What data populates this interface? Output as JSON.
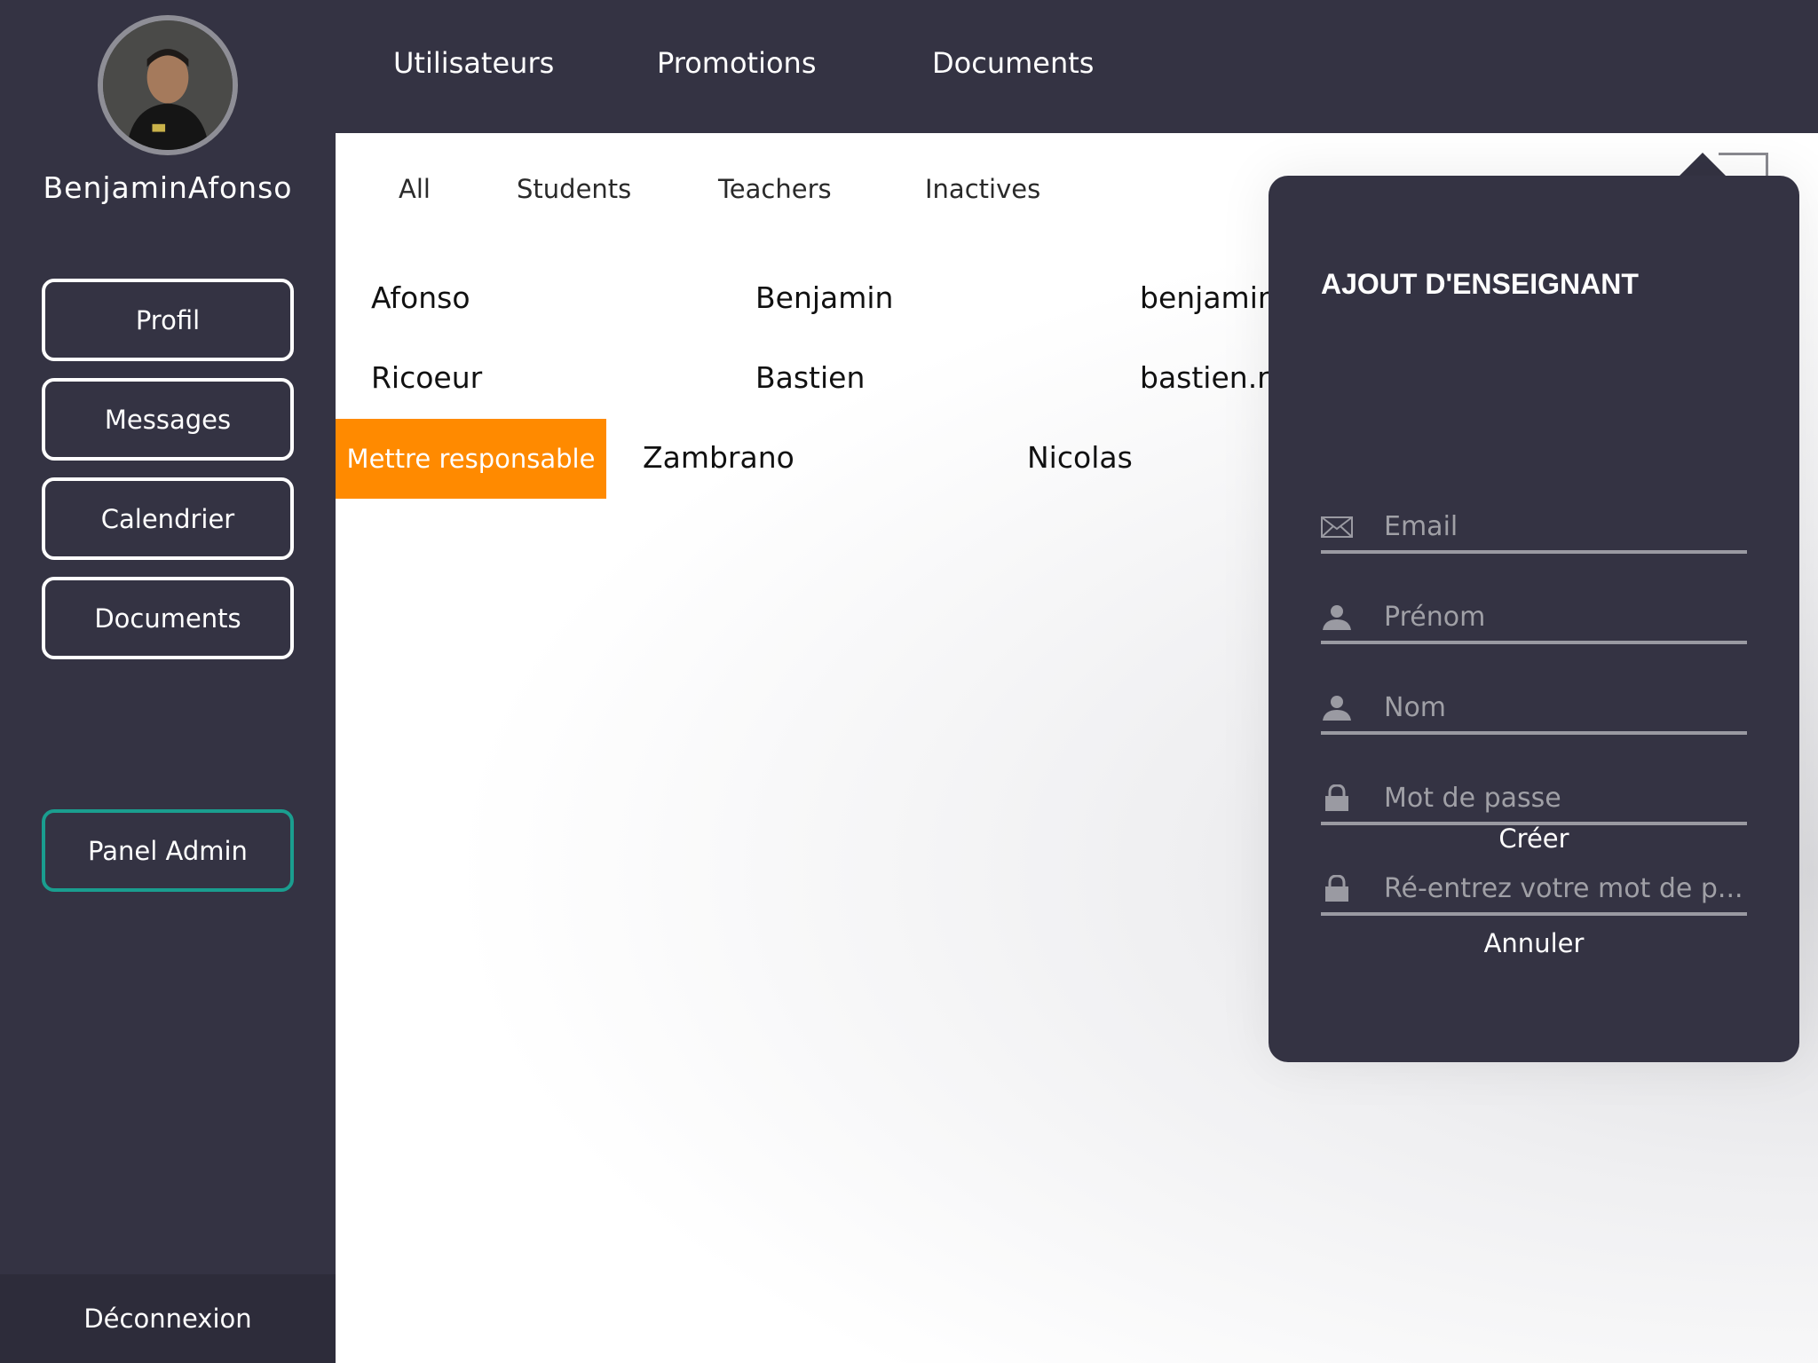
{
  "sidebar": {
    "username": "BenjaminAfonso",
    "buttons": {
      "profil": "Profil",
      "messages": "Messages",
      "calendrier": "Calendrier",
      "documents": "Documents",
      "panel_admin": "Panel Admin"
    },
    "logout": "Déconnexion"
  },
  "topnav": {
    "utilisateurs": "Utilisateurs",
    "promotions": "Promotions",
    "documents": "Documents"
  },
  "filters": [
    "All",
    "Students",
    "Teachers",
    "Inactives"
  ],
  "users": [
    {
      "nom": "Afonso",
      "prenom": "Benjamin",
      "email": "benjamin."
    },
    {
      "nom": "Ricoeur",
      "prenom": "Bastien",
      "email": "bastien.ri"
    },
    {
      "nom": "Zambrano",
      "prenom": "Nicolas",
      "email": ""
    }
  ],
  "swipe_action": "Mettre responsable",
  "popover": {
    "title": "AJOUT D'ENSEIGNANT",
    "fields": {
      "email": "Email",
      "prenom": "Prénom",
      "nom": "Nom",
      "password": "Mot de passe",
      "password_confirm": "Ré-entrez votre mot de p..."
    },
    "create": "Créer",
    "cancel": "Annuler"
  },
  "colors": {
    "dark": "#343343",
    "accent_orange": "#ff8a00",
    "admin_teal": "#1a9e8f"
  }
}
